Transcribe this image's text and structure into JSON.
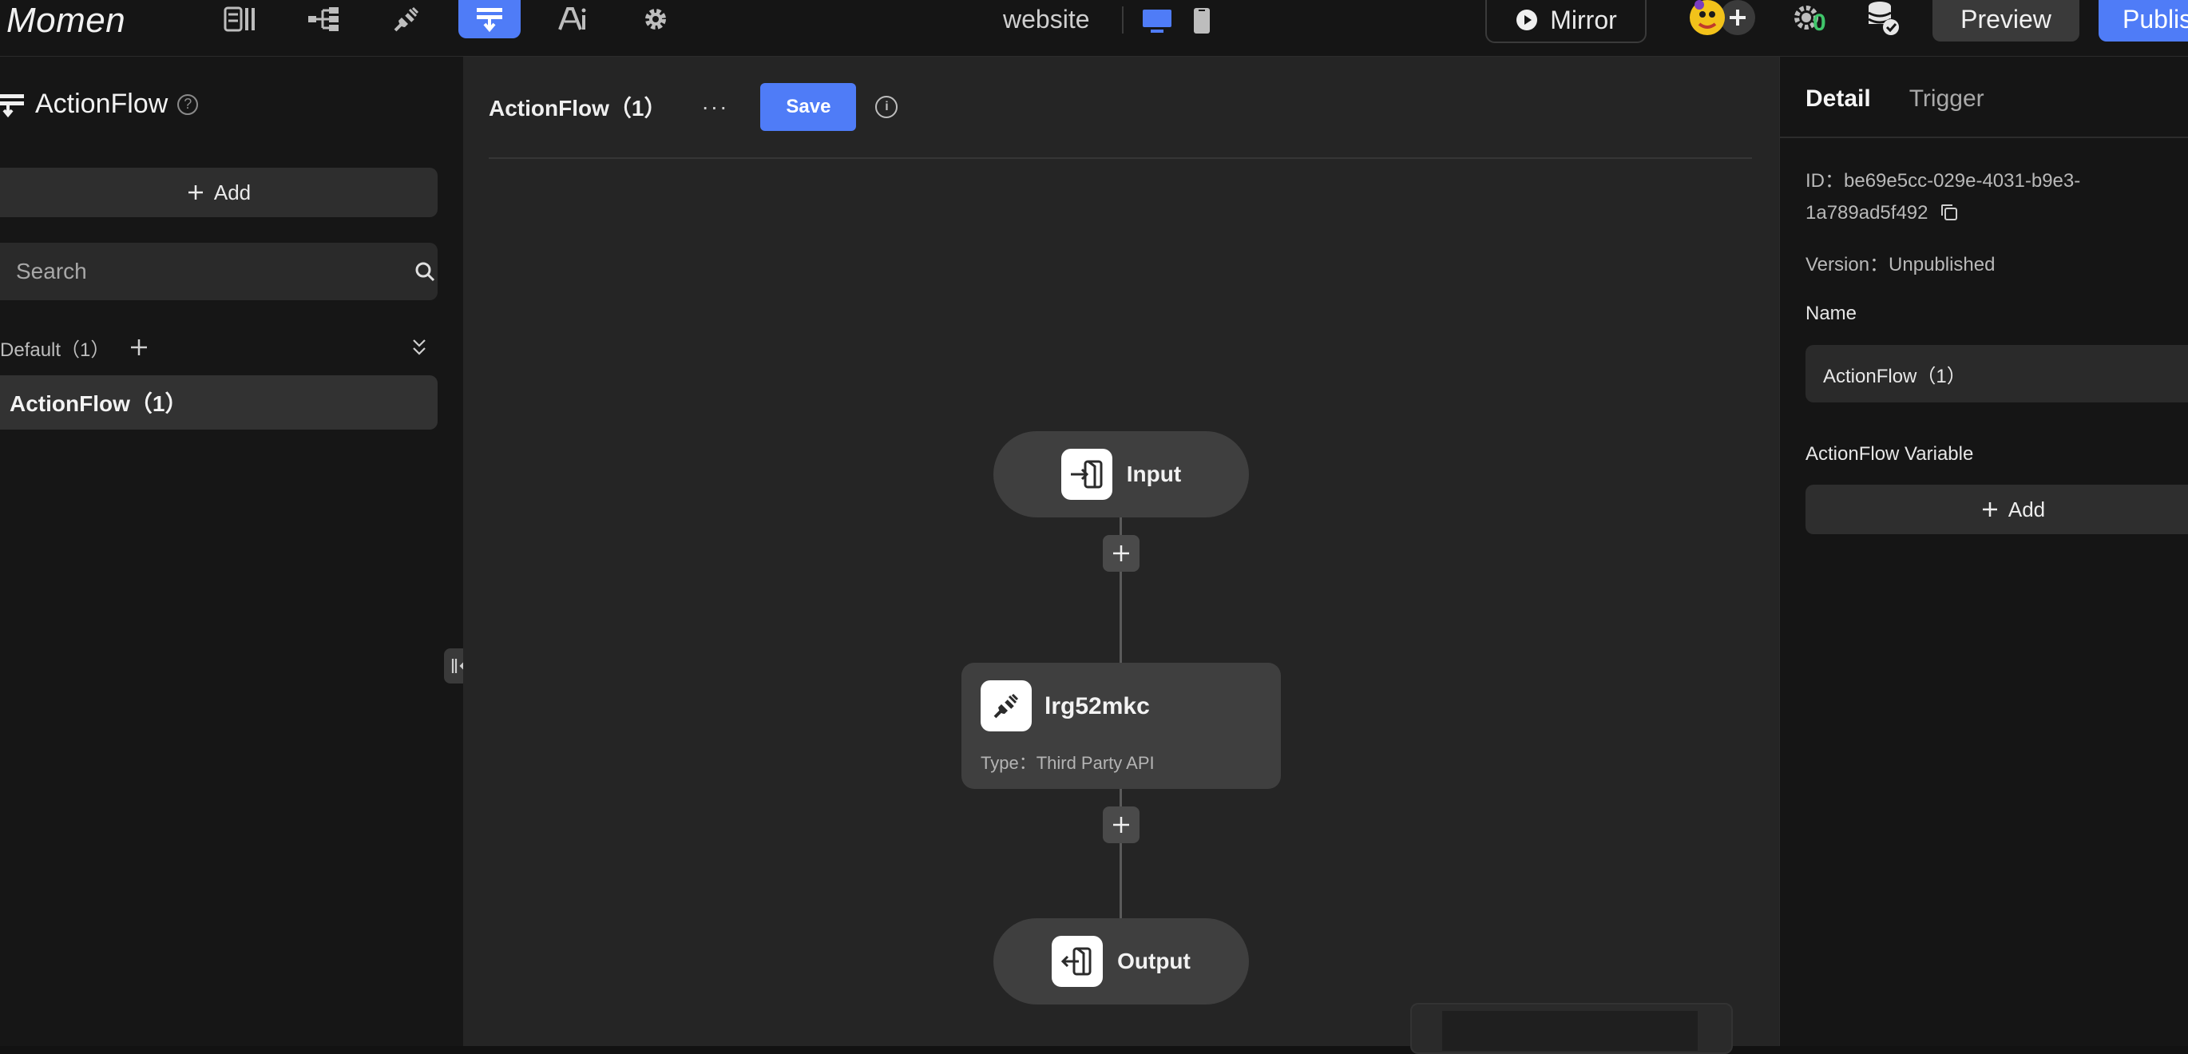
{
  "topbar": {
    "logo": "Momen",
    "nav_icons": [
      "data-icon",
      "hierarchy-icon",
      "plugin-icon",
      "actionflow-icon",
      "ai-icon",
      "gear-icon"
    ],
    "site_name": "website",
    "mirror_label": "Mirror",
    "debug_badge": "0",
    "preview_label": "Preview",
    "publish_label": "Publis"
  },
  "sidebar": {
    "title": "ActionFlow",
    "add_label": "Add",
    "search_placeholder": "Search",
    "group_label": "Default（1）",
    "items": [
      {
        "label": "ActionFlow（1）"
      }
    ]
  },
  "canvas": {
    "title": "ActionFlow（1）",
    "more_label": "···",
    "save_label": "Save",
    "nodes": {
      "input_label": "Input",
      "api_name": "lrg52mkc",
      "api_type": "Type：Third Party API",
      "output_label": "Output"
    }
  },
  "right_panel": {
    "tabs": [
      "Detail",
      "Trigger"
    ],
    "id_text": "ID：be69e5cc-029e-4031-b9e3-1a789ad5f492",
    "version_text": "Version：Unpublished",
    "name_label": "Name",
    "name_value": "ActionFlow（1）",
    "variable_label": "ActionFlow Variable",
    "add_label": "Add"
  },
  "colors": {
    "accent": "#4f7cf7",
    "background": "#121212",
    "canvas": "#252525",
    "node": "#3f3f3f"
  }
}
